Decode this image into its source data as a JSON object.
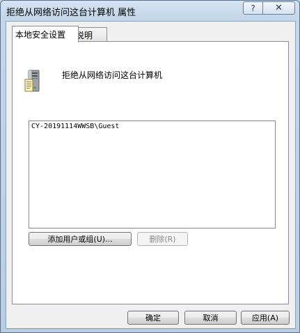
{
  "window": {
    "title": "拒绝从网络访问这台计算机 属性",
    "help_label": "?",
    "close_label": "✕"
  },
  "tabs": [
    {
      "label": "本地安全设置",
      "active": true
    },
    {
      "label": "说明",
      "active": false
    }
  ],
  "policy": {
    "icon": "computer-icon",
    "name": "拒绝从网络访问这台计算机"
  },
  "accounts": [
    "CY-20191114WWSB\\Guest"
  ],
  "buttons": {
    "add": "添加用户或组(U)...",
    "remove": "删除(R)",
    "ok": "确定",
    "cancel": "取消",
    "apply": "应用(A)"
  }
}
